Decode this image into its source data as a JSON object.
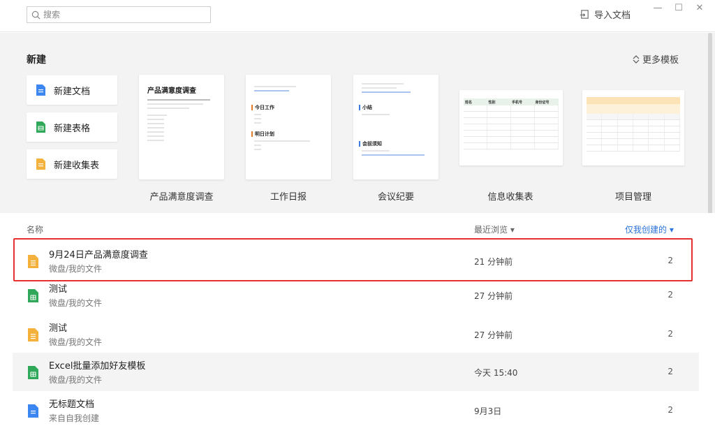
{
  "search": {
    "placeholder": "搜索"
  },
  "header": {
    "import_label": "导入文档"
  },
  "new_section": {
    "title": "新建",
    "more_templates": "更多模板",
    "buttons": [
      {
        "label": "新建文档",
        "icon": "doc-icon",
        "color": "#3b86f0"
      },
      {
        "label": "新建表格",
        "icon": "sheet-icon",
        "color": "#2fa85a"
      },
      {
        "label": "新建收集表",
        "icon": "form-icon",
        "color": "#f4b23c"
      }
    ],
    "templates": [
      {
        "label": "产品满意度调查",
        "heading": "产品满意度调查"
      },
      {
        "label": "工作日报",
        "sec1": "今日工作",
        "sec2": "明日计划"
      },
      {
        "label": "会议纪要",
        "sec1": "小结",
        "sec2": "会前须知"
      },
      {
        "label": "信息收集表",
        "cols": [
          "姓名",
          "性别",
          "手机号",
          "身份证号"
        ]
      },
      {
        "label": "项目管理"
      }
    ]
  },
  "list": {
    "col_name": "名称",
    "col_recent": "最近浏览 ▾",
    "col_filter": "仅我创建的 ▾",
    "files": [
      {
        "name": "9月24日产品满意度调查",
        "path": "微盘/我的文件",
        "time": "21 分钟前",
        "count": "2",
        "type": "form"
      },
      {
        "name": "测试",
        "path": "微盘/我的文件",
        "time": "27 分钟前",
        "count": "2",
        "type": "sheet"
      },
      {
        "name": "测试",
        "path": "微盘/我的文件",
        "time": "27 分钟前",
        "count": "2",
        "type": "form"
      },
      {
        "name": "Excel批量添加好友模板",
        "path": "微盘/我的文件",
        "time": "今天 15:40",
        "count": "2",
        "type": "sheet"
      },
      {
        "name": "无标题文档",
        "path": "来自自我创建",
        "time": "9月3日",
        "count": "2",
        "type": "doc"
      }
    ]
  },
  "colors": {
    "accent": "#2a72d8",
    "highlight": "#e53030",
    "doc": "#3b86f0",
    "sheet": "#2fa85a",
    "form": "#f4b23c"
  }
}
